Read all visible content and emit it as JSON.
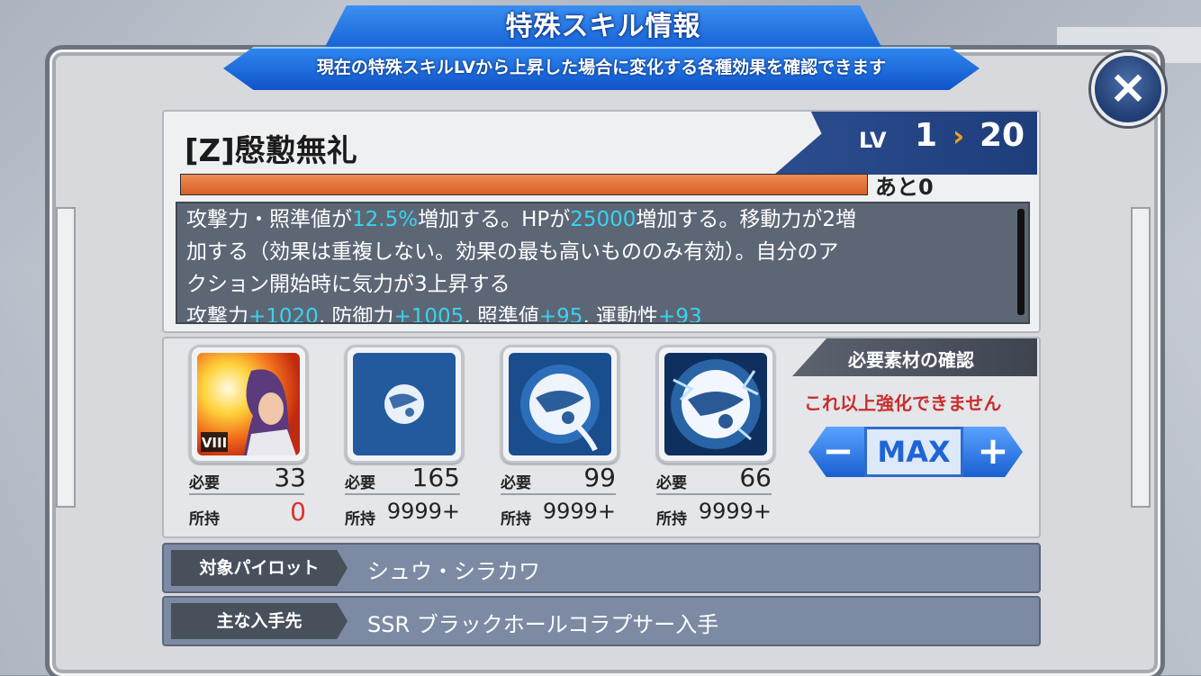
{
  "header": {
    "title": "特殊スキル情報",
    "subtitle": "現在の特殊スキルLVから上昇した場合に変化する各種効果を確認できます"
  },
  "skill": {
    "name": "[Z]慇懃無礼",
    "lv_label": "LV",
    "lv_current": "1",
    "lv_arrow": "›",
    "lv_max": "20",
    "exp_fill_fraction": 1.0,
    "exp_remaining": "あと0",
    "desc_line1_a": "攻撃力・照準値が",
    "desc_line1_b": "12.5%",
    "desc_line1_c": "増加する。HPが",
    "desc_line1_d": "25000",
    "desc_line1_e": "増加する。移動力が2増",
    "desc_line2": "加する（効果は重複しない。効果の最も高いもののみ有効）。自分のア",
    "desc_line3": "クション開始時に気力が3上昇する",
    "stat_atk_label": "攻撃力",
    "stat_atk": "+1020",
    "stat_def_label": ", 防御力",
    "stat_def": "+1005",
    "stat_acc_label": ", 照準値",
    "stat_acc": "+95",
    "stat_mob_label": ", 運動性",
    "stat_mob": "+93"
  },
  "materials": [
    {
      "name": "pilot-card",
      "badge": "VIII",
      "need_label": "必要",
      "need": "33",
      "have_label": "所持",
      "have": "0"
    },
    {
      "name": "orb-small",
      "need_label": "必要",
      "need": "165",
      "have_label": "所持",
      "have": "9999+"
    },
    {
      "name": "orb-medium",
      "need_label": "必要",
      "need": "99",
      "have_label": "所持",
      "have": "9999+"
    },
    {
      "name": "orb-large",
      "need_label": "必要",
      "need": "66",
      "have_label": "所持",
      "have": "9999+"
    }
  ],
  "requirement": {
    "header": "必要素材の確認",
    "warning": "これ以上強化できません",
    "minus": "−",
    "max": "MAX",
    "plus": "+"
  },
  "info": {
    "pilot_label": "対象パイロット",
    "pilot_value": "シュウ・シラカワ",
    "source_label": "主な入手先",
    "source_value": "SSR ブラックホールコラプサー入手"
  },
  "colors": {
    "accent": "#1762d6",
    "highlight": "#39d3f0",
    "warning": "#c92d2d",
    "exp_bar": "#e0703a"
  },
  "icons": {
    "close": "close-icon"
  }
}
